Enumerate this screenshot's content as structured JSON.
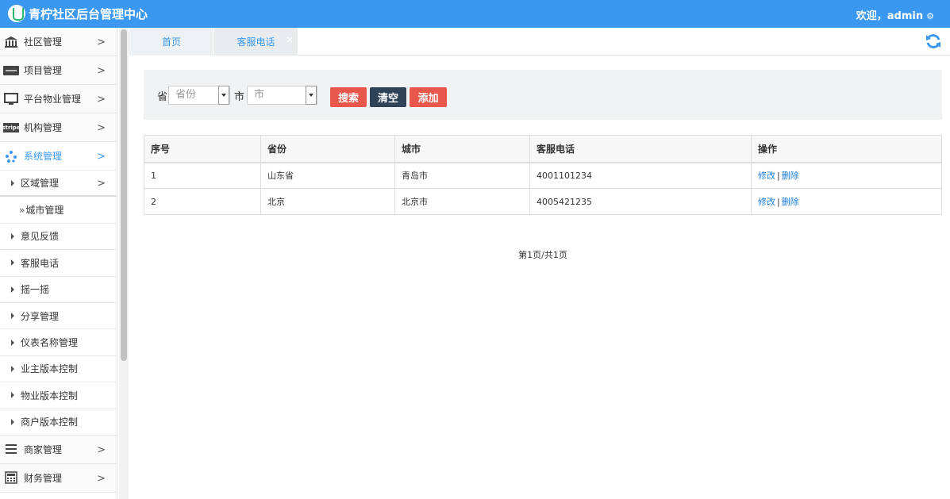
{
  "header": {
    "title": "青柠社区后台管理中心",
    "welcome": "欢迎，admin"
  },
  "sidebar": {
    "items": [
      {
        "label": "社区管理",
        "icon": "bank-icon"
      },
      {
        "label": "项目管理",
        "icon": "discover-card-icon"
      },
      {
        "label": "平台物业管理",
        "icon": "monitor-icon"
      },
      {
        "label": "机构管理",
        "icon": "stripe-icon",
        "icon_text": "stripe"
      },
      {
        "label": "系统管理",
        "icon": "yelp-icon",
        "active": true
      },
      {
        "label": "商家管理",
        "icon": "bars-icon"
      },
      {
        "label": "财务管理",
        "icon": "calculator-icon"
      }
    ],
    "subitems": [
      {
        "label": "区域管理",
        "expandable": true
      },
      {
        "label": "城市管理",
        "prefix": "»",
        "leaf": true
      },
      {
        "label": "意见反馈"
      },
      {
        "label": "客服电话"
      },
      {
        "label": "摇一摇"
      },
      {
        "label": "分享管理"
      },
      {
        "label": "仪表名称管理"
      },
      {
        "label": "业主版本控制"
      },
      {
        "label": "物业版本控制"
      },
      {
        "label": "商户版本控制"
      }
    ]
  },
  "tabs": [
    {
      "label": "首页"
    },
    {
      "label": "客服电话",
      "close": "×"
    }
  ],
  "search": {
    "province_label": "省",
    "province_placeholder": "省份",
    "city_label": "市",
    "city_placeholder": "市",
    "search_button": "搜索",
    "clear_button": "清空",
    "add_button": "添加"
  },
  "table": {
    "headers": [
      "序号",
      "省份",
      "城市",
      "客服电话",
      "操作"
    ],
    "rows": [
      {
        "no": "1",
        "province": "山东省",
        "city": "青岛市",
        "phone": "4001101234"
      },
      {
        "no": "2",
        "province": "北京",
        "city": "北京市",
        "phone": "4005421235"
      }
    ],
    "edit": "修改",
    "sep": "|",
    "delete": "删除"
  },
  "pager": {
    "text": "第1页/共1页"
  },
  "colors": {
    "header": "#3a98f0",
    "accent": "#3a98f0",
    "danger": "#e9564c",
    "dark": "#2e4358"
  }
}
